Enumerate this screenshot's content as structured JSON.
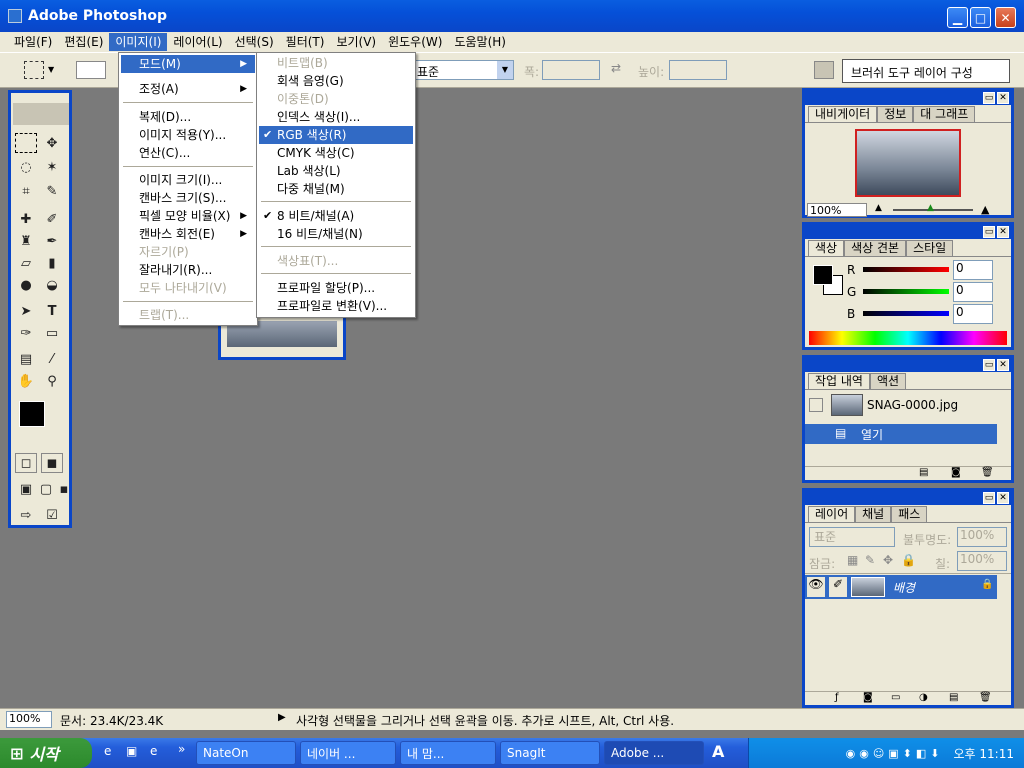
{
  "window": {
    "title": "Adobe Photoshop"
  },
  "menubar": [
    "파일(F)",
    "편집(E)",
    "이미지(I)",
    "레이어(L)",
    "선택(S)",
    "필터(T)",
    "보기(V)",
    "윈도우(W)",
    "도움말(H)"
  ],
  "optionbar": {
    "style_value": "표준",
    "width_label": "폭:",
    "height_label": "높이:",
    "palette_well": "브러쉬 도구 레이어 구성"
  },
  "image_menu": {
    "items": [
      {
        "label": "모드(M)",
        "submenu": true
      },
      {
        "label": "조정(A)",
        "submenu": true
      },
      {
        "label": "복제(D)..."
      },
      {
        "label": "이미지 적용(Y)..."
      },
      {
        "label": "연산(C)..."
      },
      {
        "label": "이미지 크기(I)..."
      },
      {
        "label": "캔바스 크기(S)..."
      },
      {
        "label": "픽셀 모양 비율(X)",
        "submenu": true
      },
      {
        "label": "캔바스 회전(E)",
        "submenu": true
      },
      {
        "label": "자르기(P)",
        "disabled": true
      },
      {
        "label": "잘라내기(R)..."
      },
      {
        "label": "모두 나타내기(V)",
        "disabled": true
      },
      {
        "label": "트랩(T)...",
        "disabled": true
      }
    ]
  },
  "mode_submenu": {
    "items": [
      {
        "label": "비트맵(B)",
        "disabled": true
      },
      {
        "label": "회색 음영(G)"
      },
      {
        "label": "이중톤(D)",
        "disabled": true
      },
      {
        "label": "인덱스 색상(I)..."
      },
      {
        "label": "RGB 색상(R)",
        "checked": true,
        "selected": true
      },
      {
        "label": "CMYK 색상(C)"
      },
      {
        "label": "Lab 색상(L)"
      },
      {
        "label": "다중 채널(M)"
      },
      {
        "label": "8 비트/채널(A)",
        "checked": true
      },
      {
        "label": "16 비트/채널(N)"
      },
      {
        "label": "색상표(T)...",
        "disabled": true
      },
      {
        "label": "프로파일 할당(P)..."
      },
      {
        "label": "프로파일로 변환(V)..."
      }
    ]
  },
  "navigator": {
    "tabs": [
      "내비게이터",
      "정보",
      "대 그래프"
    ],
    "zoom": "100%"
  },
  "color_panel": {
    "tabs": [
      "색상",
      "색상 견본",
      "스타일"
    ],
    "r_label": "R",
    "g_label": "G",
    "b_label": "B",
    "r": "0",
    "g": "0",
    "b": "0"
  },
  "history": {
    "tabs": [
      "작업 내역",
      "액션"
    ],
    "snapshot": "SNAG-0000.jpg",
    "state": "열기"
  },
  "layers": {
    "tabs": [
      "레이어",
      "채널",
      "패스"
    ],
    "blend": "표준",
    "opacity_label": "불투명도:",
    "opacity": "100%",
    "lock_label": "잠금:",
    "fill_label": "칠:",
    "fill": "100%",
    "layer_name": "배경"
  },
  "status": {
    "zoom": "100%",
    "doc": "문서: 23.4K/23.4K",
    "hint": "사각형 선택물을 그리거나 선택 윤곽을 이동. 추가로 시프트, Alt, Ctrl 사용."
  },
  "taskbar": {
    "start": "시작",
    "tasks": [
      "NateOn",
      "네이버 ...",
      "내 맘...",
      "SnagIt",
      "Adobe ..."
    ],
    "clock": "오후 11:11"
  },
  "colors": {
    "accent": "#316ac5",
    "titlebar": "#0a46c8",
    "panel_bg": "#ece9d8",
    "workspace": "#7a7a7a"
  }
}
